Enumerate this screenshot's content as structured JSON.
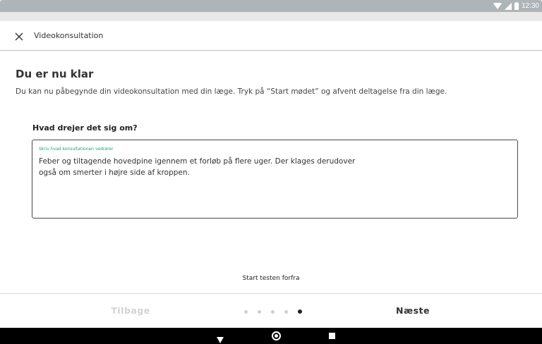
{
  "status_bar": {
    "time": "12:30",
    "icons": [
      "wifi-icon",
      "signal-icon",
      "battery-icon"
    ]
  },
  "top_bar": {
    "title": "Videokonsultation",
    "close_icon": "close-icon"
  },
  "content": {
    "heading": "Du er nu klar",
    "intro": "Du kan nu påbegynde din videokonsultation med din læge. Tryk på “Start mødet” og afvent deltagelse fra din læge.",
    "question_label": "Hvad drejer det sig om?",
    "textarea": {
      "floating_label": "Skriv hvad konsultationen vedrører",
      "value_line1": "Feber og tiltagende hovedpine igennem et forløb på flere uger. Der klages derudover",
      "value_line2": "også om smerter i højre side af kroppen."
    },
    "start_label": "Start testen forfra"
  },
  "bottom_bar": {
    "back_label": "Tilbage",
    "next_label": "Næste",
    "pager": {
      "total": 5,
      "current": 5
    }
  },
  "colors": {
    "accent_label": "#1aa77a",
    "status_bar": "#aeb5b8",
    "disabled_text": "#d3d3d3"
  },
  "nav_bar": {
    "icons": [
      "nav-back-icon",
      "nav-home-icon",
      "nav-recent-icon"
    ]
  }
}
